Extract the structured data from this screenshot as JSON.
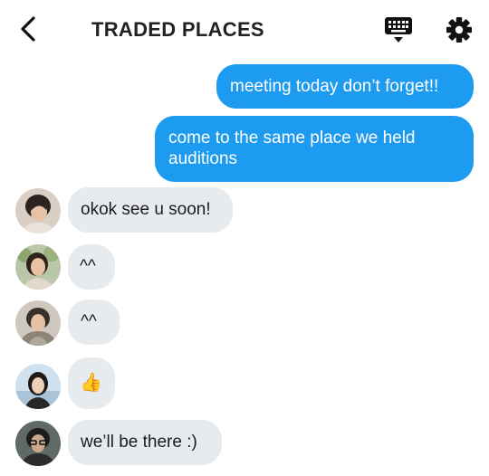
{
  "header": {
    "title": "TRADED PLACES",
    "back_icon": "chevron-left-icon",
    "keyboard_icon": "keyboard-icon",
    "settings_icon": "gear-icon"
  },
  "messages": [
    {
      "direction": "outgoing",
      "text": "meeting today don’t forget!!"
    },
    {
      "direction": "outgoing",
      "text": "come to the same place we held auditions"
    },
    {
      "direction": "incoming",
      "text": "okok see u soon!"
    },
    {
      "direction": "incoming",
      "text": "^^"
    },
    {
      "direction": "incoming",
      "text": "^^"
    },
    {
      "direction": "incoming",
      "text": "👍"
    },
    {
      "direction": "incoming",
      "text": "we’ll be there :)"
    }
  ],
  "colors": {
    "outgoing_bubble": "#1d9bf0",
    "incoming_bubble": "#e8ebee"
  }
}
